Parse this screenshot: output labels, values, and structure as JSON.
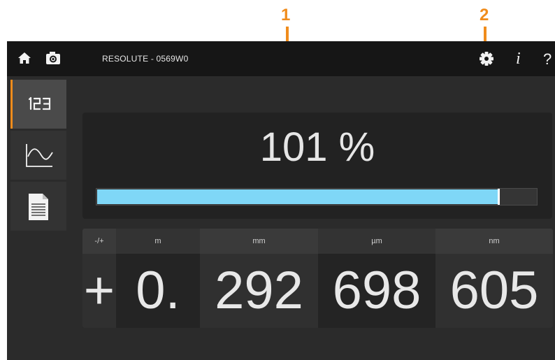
{
  "callouts": {
    "one": "1",
    "two": "2"
  },
  "header": {
    "title": "RESOLUTE - 0569W0",
    "info_glyph": "i",
    "help_glyph": "?"
  },
  "icons": {
    "home": "home-icon",
    "camera": "camera-icon",
    "settings": "gear-icon",
    "info": "info-icon",
    "help": "help-icon"
  },
  "sidebar": {
    "items": [
      {
        "icon": "digital-readout-icon",
        "glyph": "123",
        "active": true
      },
      {
        "icon": "graph-icon",
        "active": false
      },
      {
        "icon": "document-icon",
        "active": false
      }
    ]
  },
  "signal": {
    "value": "101 %",
    "fill_fraction": 0.915
  },
  "readout": {
    "columns": [
      {
        "header": "-/+",
        "value": "+"
      },
      {
        "header": "m",
        "value": "0."
      },
      {
        "header": "mm",
        "value": "292"
      },
      {
        "header": "µm",
        "value": "698"
      },
      {
        "header": "nm",
        "value": "605"
      }
    ]
  },
  "colors": {
    "accent": "#f08c1c",
    "signal_bar": "#7fd7f7",
    "background": "#2b2b2b",
    "topbar": "#161616"
  }
}
